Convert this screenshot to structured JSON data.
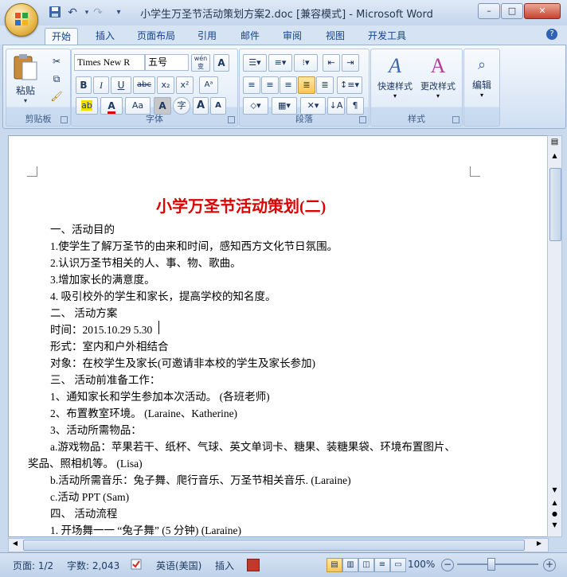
{
  "window": {
    "title": "小学生万圣节活动策划方案2.doc [兼容模式] - Microsoft Word",
    "minimize": "–",
    "maximize": "□",
    "close": "✕"
  },
  "qat": {
    "save_icon": "save-icon",
    "undo": "↶",
    "redo": "↷",
    "more": "▾"
  },
  "tabs": [
    "开始",
    "插入",
    "页面布局",
    "引用",
    "邮件",
    "审阅",
    "视图",
    "开发工具"
  ],
  "help": "?",
  "clipboard": {
    "paste": "粘贴",
    "label": "剪贴板"
  },
  "font": {
    "name": "Times New R",
    "size": "五号",
    "wen": "wén",
    "bold": "B",
    "italic": "I",
    "underline": "U",
    "strike": "abc",
    "sub": "x₂",
    "sup": "x²",
    "change_case": "Aa",
    "grow": "A",
    "shrink": "A",
    "highlight": "ab",
    "font_color": "A",
    "char_shade": "A",
    "enclose": "字",
    "label": "字体",
    "highlight_color": "#f4e000",
    "font_color_value": "#e00000"
  },
  "paragraph": {
    "label": "段落"
  },
  "styles": {
    "quick": "快速样式",
    "change": "更改样式",
    "label": "样式"
  },
  "editing": {
    "label": "编辑"
  },
  "document": {
    "title": "小学万圣节活动策划(二)",
    "lines": [
      "一、活动目的",
      "1.使学生了解万圣节的由来和时间，感知西方文化节日氛围。",
      "2.认识万圣节相关的人、事、物、歌曲。",
      "3.增加家长的满意度。",
      "4.  吸引校外的学生和家长，提高学校的知名度。",
      "二、  活动方案",
      "时间：2015.10.29 5.30",
      "形式：室内和户外相结合",
      "对象：在校学生及家长(可邀请非本校的学生及家长参加)",
      "三、  活动前准备工作：",
      "1、通知家长和学生参加本次活动。 (各班老师)",
      "2、布置教室环境。  (Laraine、Katherine)",
      "3、活动所需物品：",
      "a.游戏物品：苹果若干、纸杯、气球、英文单词卡、糖果、装糖果袋、环境布置图片、",
      "奖品、照相机等。 (Lisa)",
      "b.活动所需音乐：兔子舞、爬行音乐、万圣节相关音乐. (Laraine)",
      "c.活动 PPT (Sam)",
      "四、  活动流程",
      "1.  开场舞一一 “兔子舞” (5 分钟) (Laraine)"
    ],
    "title_color": "#dd0000"
  },
  "status": {
    "page": "页面: 1/2",
    "words": "字数: 2,043",
    "language": "英语(美国)",
    "insert": "插入",
    "zoom": "100%"
  }
}
